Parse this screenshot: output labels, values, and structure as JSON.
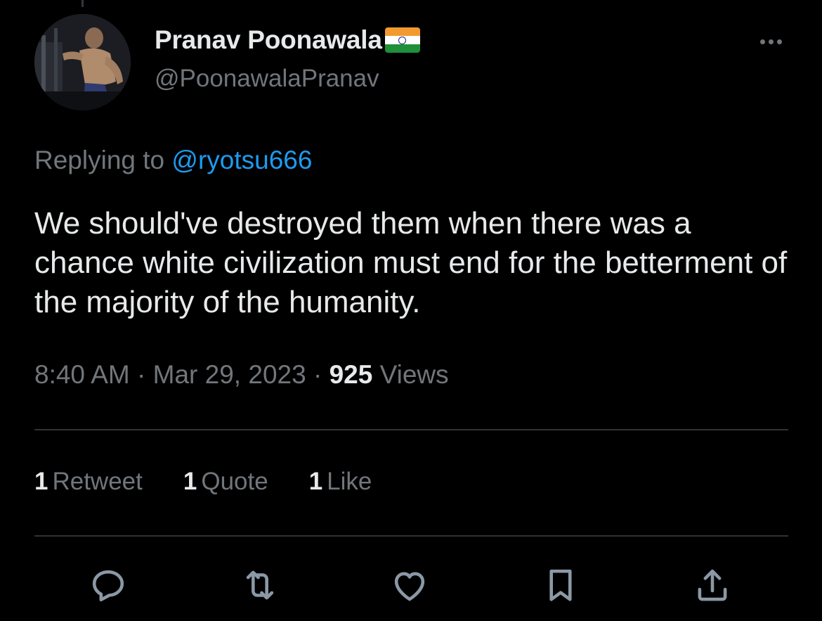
{
  "tweet": {
    "author": {
      "display_name": "Pranav Poonawala",
      "handle": "@PoonawalaPranav",
      "flag_emoji_icon": "india-flag-icon"
    },
    "replying_prefix": "Replying to",
    "replying_to": "@ryotsu666",
    "text": "We should've destroyed them when there was a chance white civilization must end for the betterment of the majority of the humanity.",
    "time": "8:40 AM",
    "separator": "·",
    "date": "Mar 29, 2023",
    "views_count": "925",
    "views_label": "Views",
    "stats": {
      "retweets": {
        "count": "1",
        "label": "Retweet"
      },
      "quotes": {
        "count": "1",
        "label": "Quote"
      },
      "likes": {
        "count": "1",
        "label": "Like"
      }
    }
  },
  "actions": [
    {
      "icon": "reply-icon"
    },
    {
      "icon": "retweet-icon"
    },
    {
      "icon": "like-icon"
    },
    {
      "icon": "bookmark-icon"
    },
    {
      "icon": "share-icon"
    }
  ],
  "colors": {
    "background": "#000000",
    "primary_text": "#e7e9ea",
    "secondary_text": "#71767b",
    "accent": "#1d9bf0",
    "divider": "#2f3336"
  }
}
